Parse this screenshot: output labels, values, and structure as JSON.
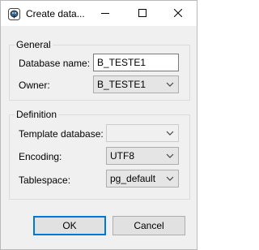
{
  "window": {
    "title": "Create data...",
    "app_icon": "postgres-elephant-icon"
  },
  "titlebar_buttons": {
    "minimize_icon": "minimize-icon",
    "maximize_icon": "maximize-icon",
    "close_icon": "close-icon"
  },
  "general": {
    "legend": "General",
    "database_name_label": "Database name:",
    "database_name_value": "B_TESTE1",
    "owner_label": "Owner:",
    "owner_value": "B_TESTE1"
  },
  "definition": {
    "legend": "Definition",
    "template_label": "Template database:",
    "template_value": "",
    "encoding_label": "Encoding:",
    "encoding_value": "UTF8",
    "tablespace_label": "Tablespace:",
    "tablespace_value": "pg_default"
  },
  "buttons": {
    "ok": "OK",
    "cancel": "Cancel"
  }
}
